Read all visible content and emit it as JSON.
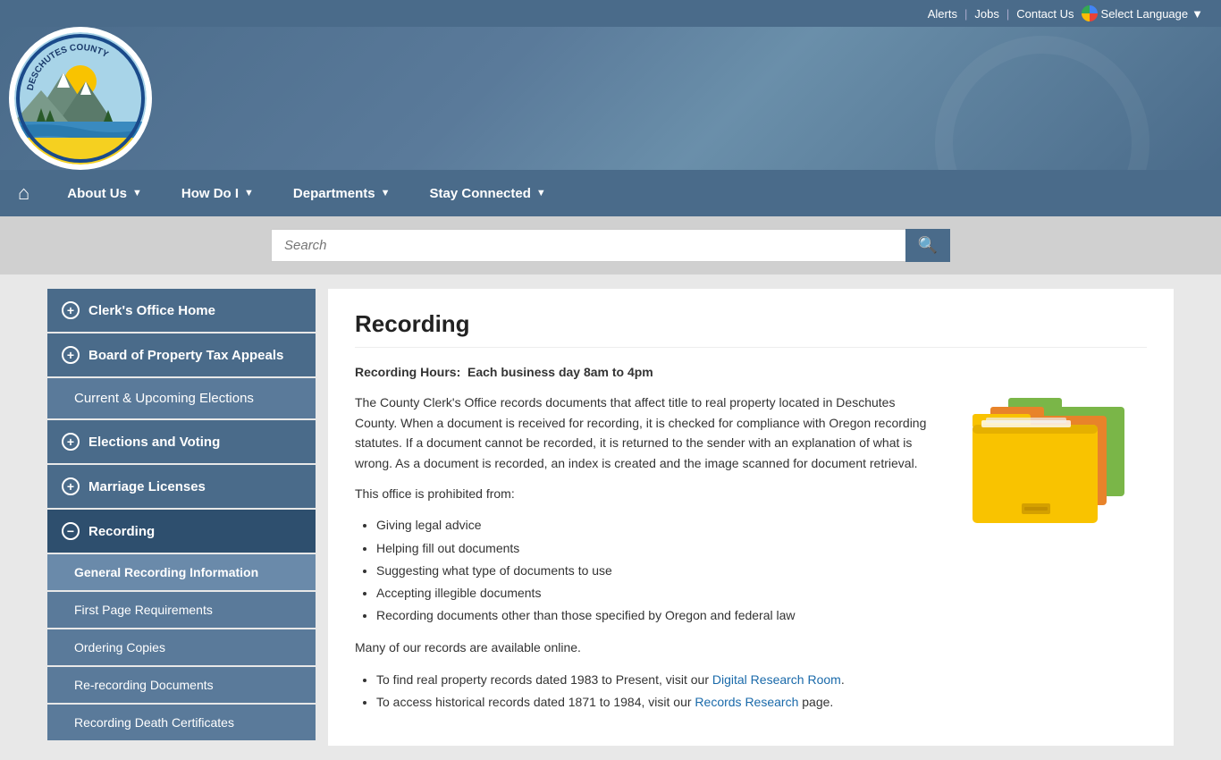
{
  "topbar": {
    "alerts": "Alerts",
    "jobs": "Jobs",
    "contact": "Contact Us",
    "selectLanguage": "Select Language"
  },
  "header": {
    "countyName": "DESCHUTES COUNTY"
  },
  "nav": {
    "home_icon": "⌂",
    "items": [
      {
        "label": "About Us",
        "has_arrow": true
      },
      {
        "label": "How Do I",
        "has_arrow": true
      },
      {
        "label": "Departments",
        "has_arrow": true
      },
      {
        "label": "Stay Connected",
        "has_arrow": true
      }
    ]
  },
  "search": {
    "placeholder": "Search",
    "button_icon": "🔍"
  },
  "sidebar": {
    "items": [
      {
        "label": "Clerk's Office Home",
        "icon": "+",
        "has_sub": false
      },
      {
        "label": "Board of Property Tax Appeals",
        "icon": "+",
        "has_sub": false
      },
      {
        "label": "Current & Upcoming Elections",
        "icon": null,
        "has_sub": false
      },
      {
        "label": "Elections and Voting",
        "icon": "+",
        "has_sub": false
      },
      {
        "label": "Marriage Licenses",
        "icon": "+",
        "has_sub": false
      },
      {
        "label": "Recording",
        "icon": "−",
        "active": true,
        "has_sub": true
      }
    ],
    "sub_items": [
      {
        "label": "General Recording Information",
        "current": true
      },
      {
        "label": "First Page Requirements"
      },
      {
        "label": "Ordering Copies"
      },
      {
        "label": "Re-recording Documents"
      },
      {
        "label": "Recording Death Certificates"
      }
    ]
  },
  "content": {
    "title": "Recording",
    "hours_label": "Recording Hours:",
    "hours_value": "Each business day 8am to 4pm",
    "para1": "The County Clerk's Office records documents that affect title to real property located in Deschutes County. When a document is received for recording, it is checked for compliance with Oregon recording statutes. If a document cannot be recorded, it is returned to the sender with an explanation of what is wrong. As a document is recorded, an index is created and the image scanned for document retrieval.",
    "prohibited_intro": "This office is prohibited from:",
    "prohibited_items": [
      "Giving legal advice",
      "Helping fill out documents",
      "Suggesting what type of documents to use",
      "Accepting illegible documents",
      "Recording documents other than those specified by Oregon and federal law"
    ],
    "online_para": "Many of our records are available online.",
    "online_items_prefix1": "To find real property records dated 1983 to Present, visit our ",
    "online_link1": "Digital Research Room",
    "online_items_prefix2": "To access historical records dated 1871 to 1984, visit our ",
    "online_link2": "Records Research",
    "online_items_suffix2": " page."
  }
}
